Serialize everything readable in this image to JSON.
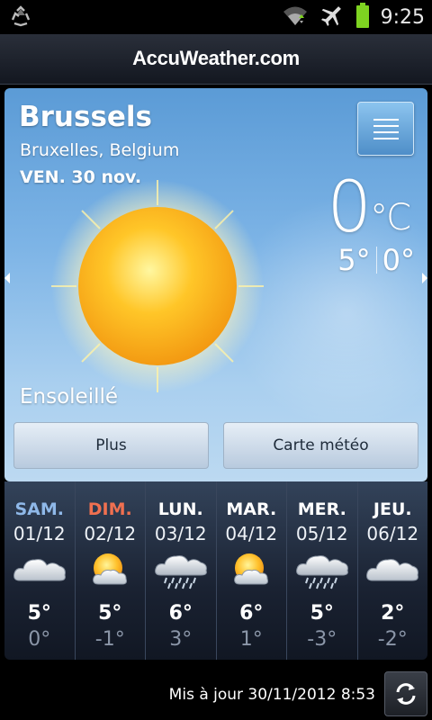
{
  "status_bar": {
    "time": "9:25",
    "icons": [
      "recycle-icon",
      "wifi-icon",
      "airplane-mode-icon",
      "battery-icon"
    ],
    "battery_color": "#7ed321"
  },
  "header": {
    "brand": "AccuWeather.com"
  },
  "current": {
    "city": "Brussels",
    "region": "Bruxelles, Belgium",
    "date": "VEN. 30 nov.",
    "temp": "0",
    "unit_deg": "°",
    "unit": "C",
    "high": "5°",
    "low": "0°",
    "condition": "Ensoleillé",
    "icon": "sun-icon"
  },
  "buttons": {
    "more": "Plus",
    "map": "Carte météo"
  },
  "forecast": [
    {
      "name": "SAM.",
      "date": "01/12",
      "icon": "cloudy-icon",
      "hi": "5°",
      "lo": "0°",
      "name_color": "#8fb8e8"
    },
    {
      "name": "DIM.",
      "date": "02/12",
      "icon": "partly-sunny-icon",
      "hi": "5°",
      "lo": "-1°",
      "name_color": "#f07050"
    },
    {
      "name": "LUN.",
      "date": "03/12",
      "icon": "rain-icon",
      "hi": "6°",
      "lo": "3°",
      "name_color": "#ffffff"
    },
    {
      "name": "MAR.",
      "date": "04/12",
      "icon": "partly-sunny-icon",
      "hi": "6°",
      "lo": "1°",
      "name_color": "#ffffff"
    },
    {
      "name": "MER.",
      "date": "05/12",
      "icon": "rain-icon",
      "hi": "5°",
      "lo": "-3°",
      "name_color": "#ffffff"
    },
    {
      "name": "JEU.",
      "date": "06/12",
      "icon": "cloudy-icon",
      "hi": "2°",
      "lo": "-2°",
      "name_color": "#ffffff"
    }
  ],
  "footer": {
    "updated": "Mis à jour 30/11/2012 8:53"
  }
}
